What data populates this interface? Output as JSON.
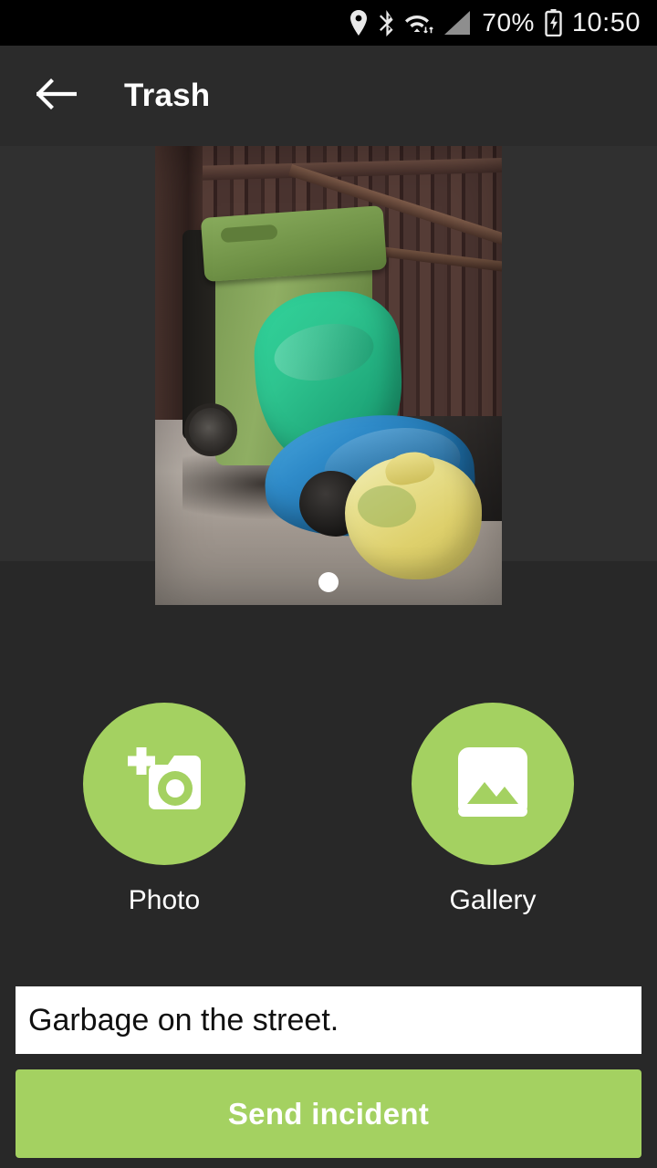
{
  "status_bar": {
    "icons": [
      "location-pin-icon",
      "bluetooth-icon",
      "wifi-icon",
      "signal-icon",
      "battery-charging-icon"
    ],
    "battery_percent": "70%",
    "clock": "10:50"
  },
  "app_bar": {
    "back_icon": "back-arrow-icon",
    "title": "Trash"
  },
  "carousel": {
    "photo_alt": "green wheelie bin with green plastic bag and blue, black and yellow garbage bags on the ground",
    "page_indicator_count": 1,
    "active_page": 1
  },
  "actions": [
    {
      "icon": "add-a-photo-icon",
      "label": "Photo"
    },
    {
      "icon": "gallery-image-icon",
      "label": "Gallery"
    }
  ],
  "description": {
    "value": "Garbage on the street.",
    "placeholder": "Description"
  },
  "submit": {
    "label": "Send incident"
  },
  "colors": {
    "accent_green": "#A4D161",
    "background": "#282828",
    "app_bar": "#2B2B2B",
    "status_bar": "#000000",
    "input_background": "#FFFFFF",
    "text_primary": "#FFFFFF"
  }
}
